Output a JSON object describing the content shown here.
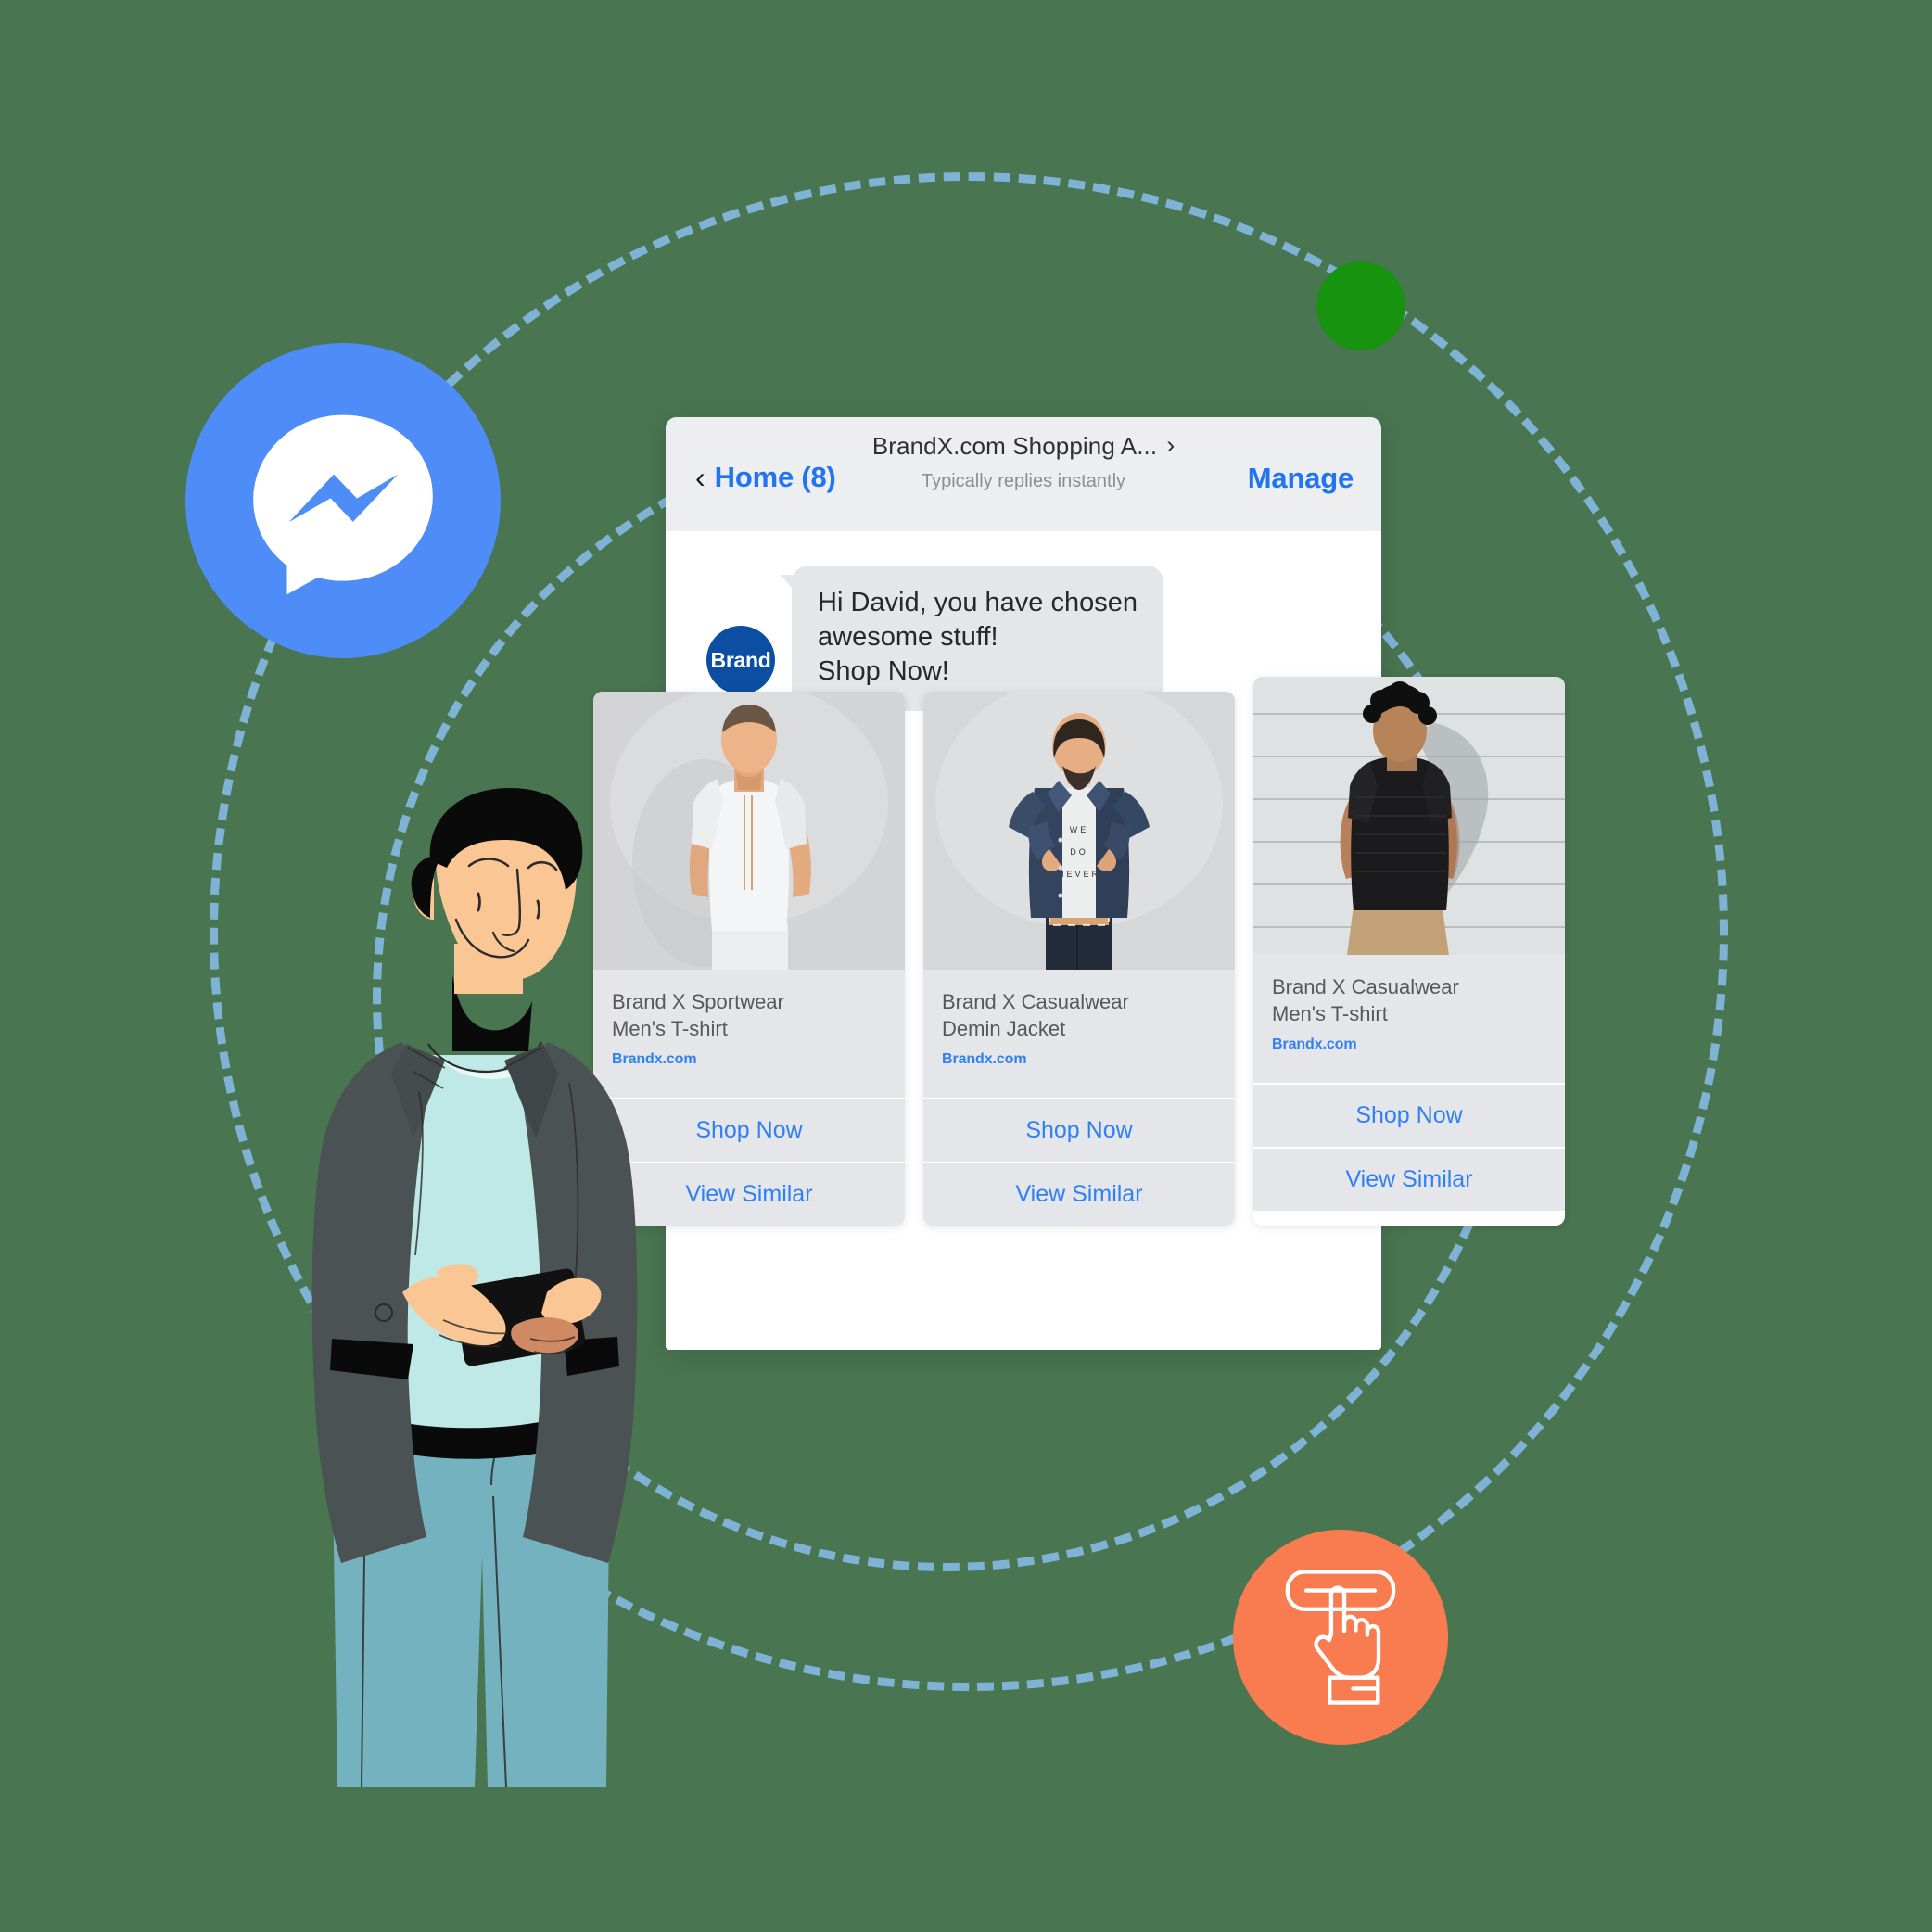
{
  "canvas": {
    "background_color": "#497550",
    "orbit_color": "#7fb3d5"
  },
  "badges": {
    "messenger": {
      "name": "Messenger",
      "color": "#4e8cf7",
      "icon": "messenger-icon"
    },
    "status_dot": {
      "color": "#17930f",
      "icon": "status-dot-icon"
    },
    "click": {
      "color": "#f97b50",
      "icon": "hand-click-button-icon"
    }
  },
  "chat": {
    "header": {
      "back_icon": "‹",
      "home_label": "Home (8)",
      "title": "BrandX.com Shopping A...",
      "title_chevron": "›",
      "subtitle": "Typically replies instantly",
      "manage_label": "Manage"
    },
    "message": {
      "avatar_label": "Brand",
      "lines": [
        "Hi David, you have chosen",
        "awesome stuff!",
        "Shop Now!"
      ]
    },
    "products": [
      {
        "brand_line": "Brand X Sportwear",
        "product_line": "Men's T-shirt",
        "domain": "Brandx.com",
        "shop_label": "Shop Now",
        "similar_label": "View Similar",
        "photo_alt": "man-in-white-tshirt-photo"
      },
      {
        "brand_line": "Brand X Casualwear",
        "product_line": "Demin Jacket",
        "domain": "Brandx.com",
        "shop_label": "Shop Now",
        "similar_label": "View Similar",
        "photo_alt": "man-in-denim-jacket-photo"
      },
      {
        "brand_line": "Brand X Casualwear",
        "product_line": "Men's T-shirt",
        "domain": "Brandx.com",
        "shop_label": "Shop Now",
        "similar_label": "View Similar",
        "photo_alt": "man-leaning-on-wall-photo"
      }
    ]
  },
  "illustration": {
    "name": "man-using-phone-illustration",
    "colors": {
      "skin": "#f9c694",
      "skin_shadow": "#d08a63",
      "hair": "#0b0b0b",
      "jacket": "#4b5254",
      "shirt": "#bfe9e6",
      "jeans": "#74b2c0",
      "phone": "#111111"
    }
  }
}
